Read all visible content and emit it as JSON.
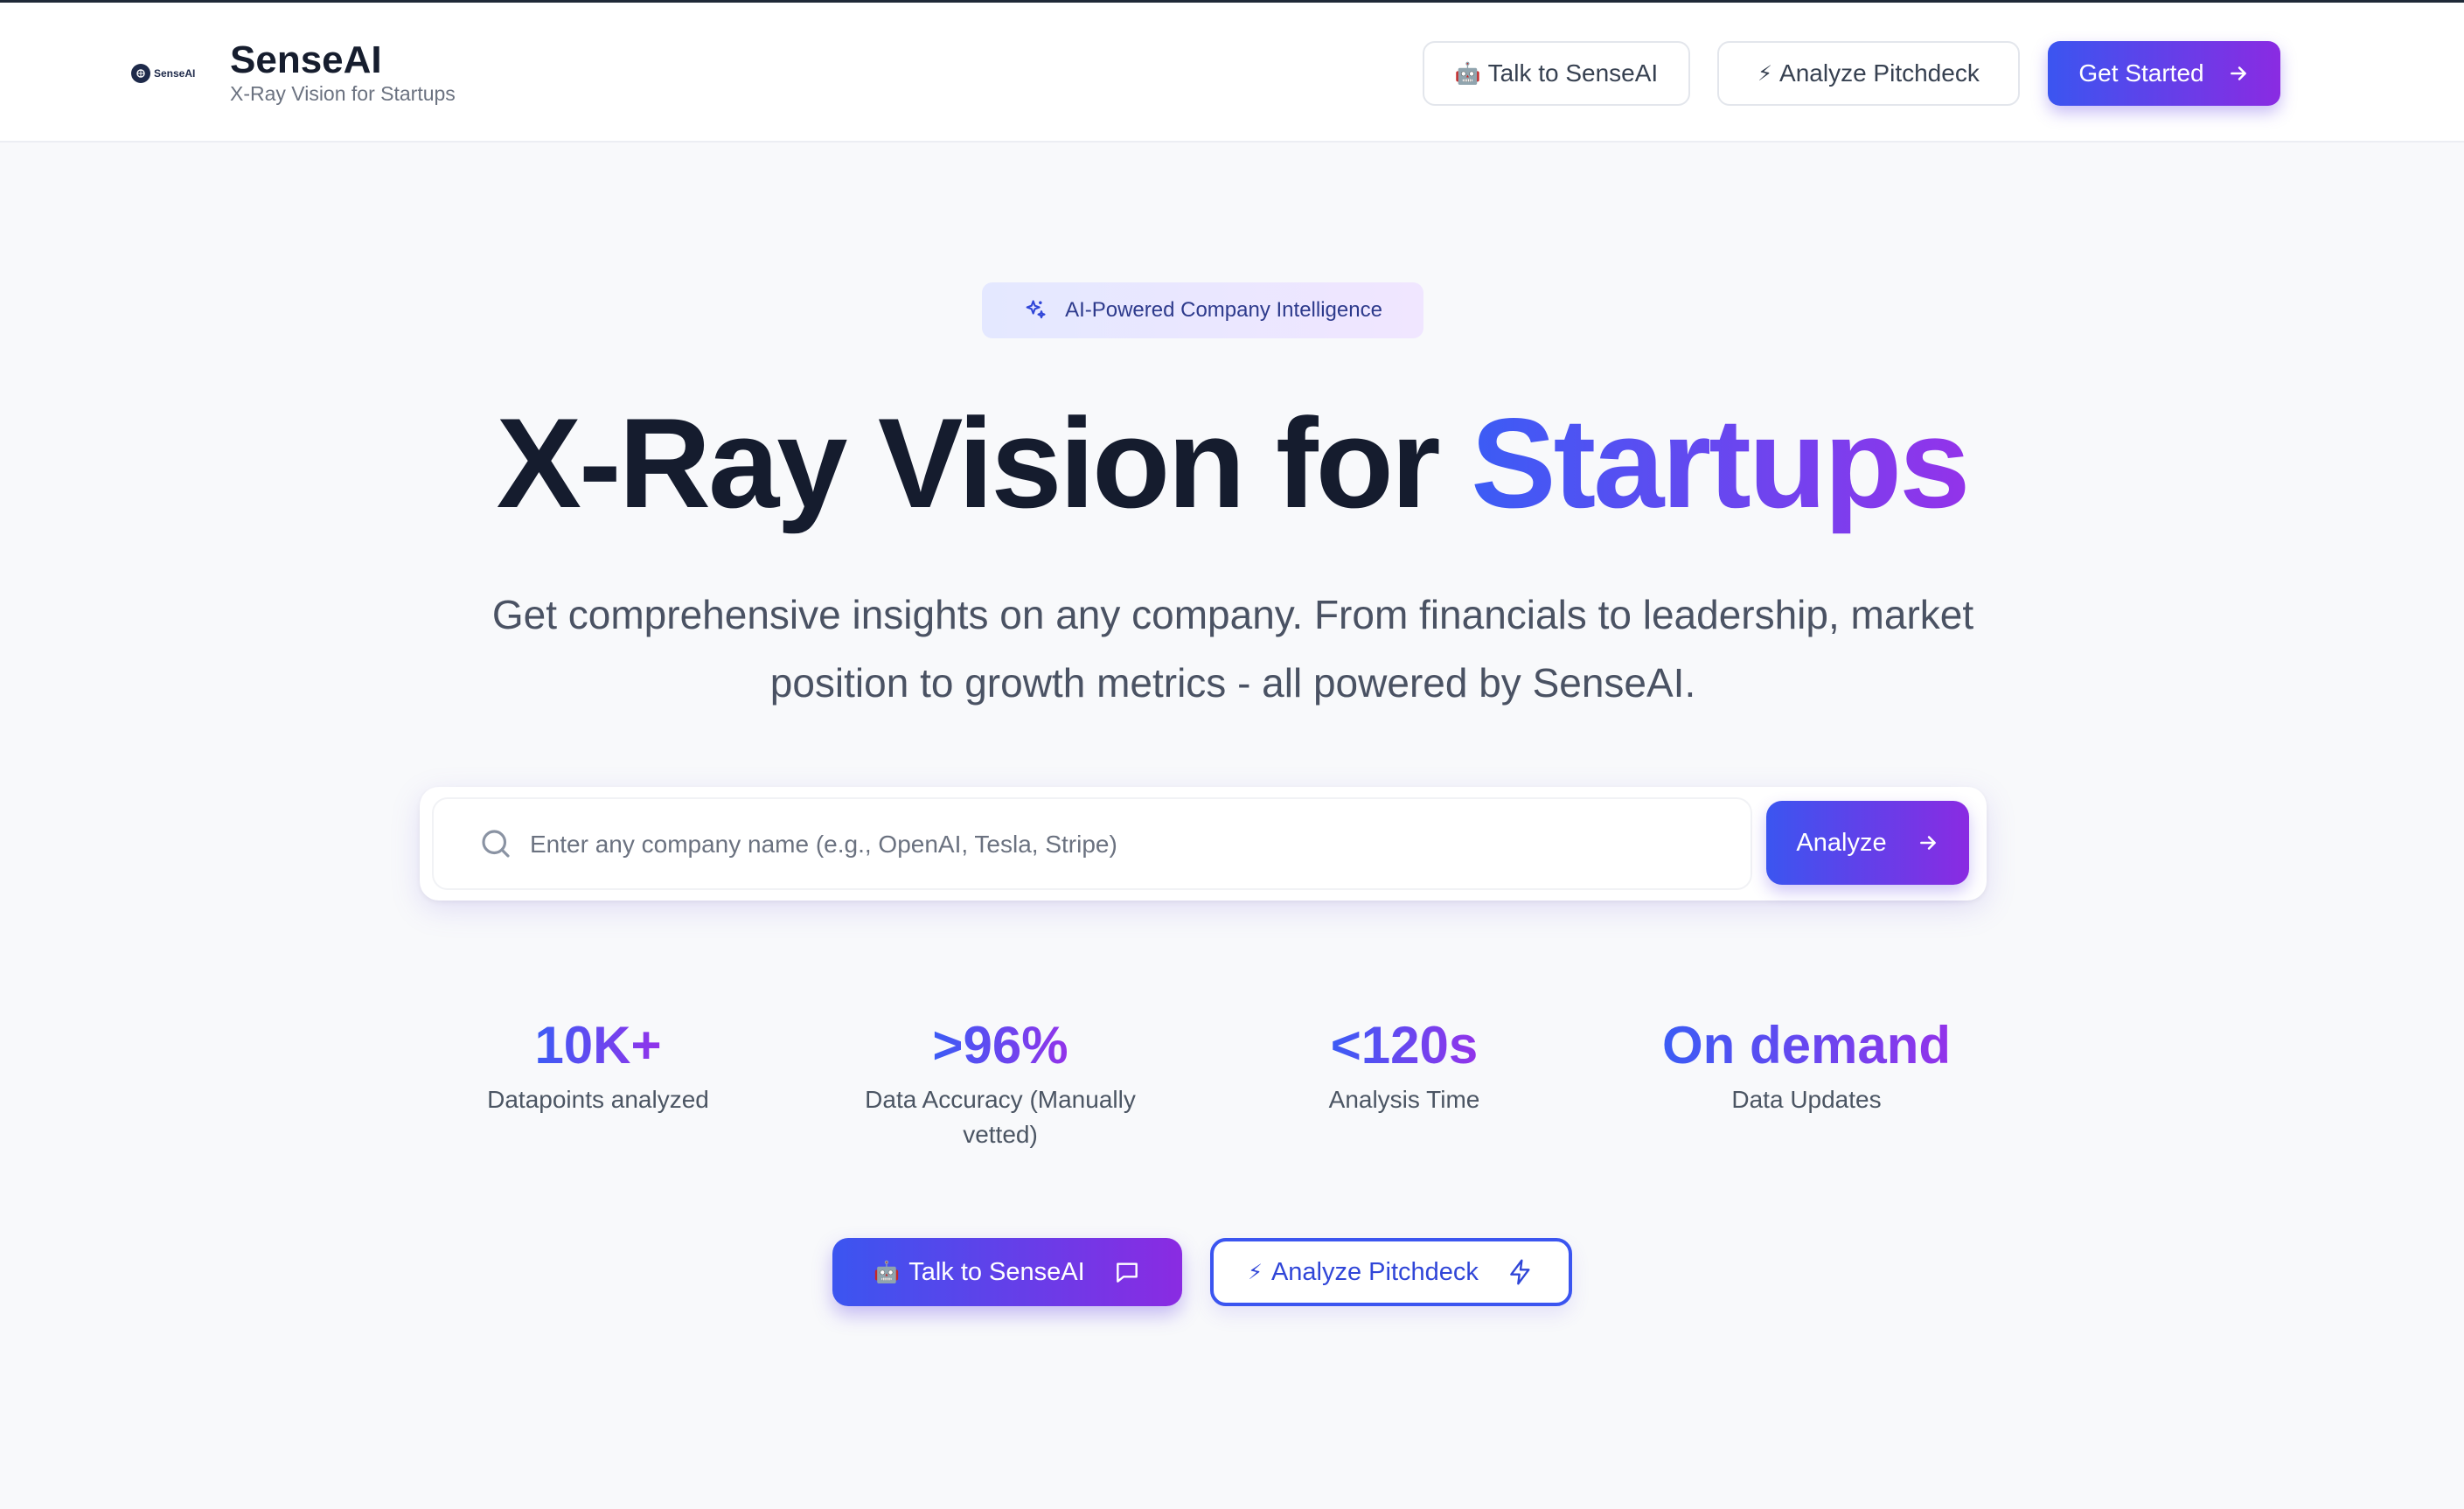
{
  "header": {
    "logo_text": "SenseAI",
    "brand_name": "SenseAI",
    "tagline": "X-Ray Vision for Startups",
    "talk_button": {
      "emoji": "🤖",
      "label": "Talk to SenseAI"
    },
    "pitch_button": {
      "emoji": "⚡",
      "label": "Analyze Pitchdeck"
    },
    "start_button": {
      "label": "Get Started"
    }
  },
  "hero": {
    "badge": "AI-Powered Company Intelligence",
    "title_main": "X-Ray Vision for ",
    "title_highlight": "Startups",
    "subtitle": "Get comprehensive insights on any company. From financials to leadership, market position to growth metrics - all powered by SenseAI."
  },
  "search": {
    "placeholder": "Enter any company name (e.g., OpenAI, Tesla, Stripe)",
    "value": "",
    "button_label": "Analyze"
  },
  "stats": [
    {
      "value": "10K+",
      "label": "Datapoints analyzed"
    },
    {
      "value": ">96%",
      "label": "Data Accuracy (Manually vetted)"
    },
    {
      "value": "<120s",
      "label": "Analysis Time"
    },
    {
      "value": "On demand",
      "label": "Data Updates"
    }
  ],
  "cta": {
    "talk": {
      "emoji": "🤖",
      "label": "Talk to SenseAI"
    },
    "pitch": {
      "emoji": "⚡",
      "label": "Analyze Pitchdeck"
    }
  },
  "colors": {
    "accent_start": "#3b55f0",
    "accent_end": "#8a2be2",
    "title_dark": "#151c2e"
  }
}
